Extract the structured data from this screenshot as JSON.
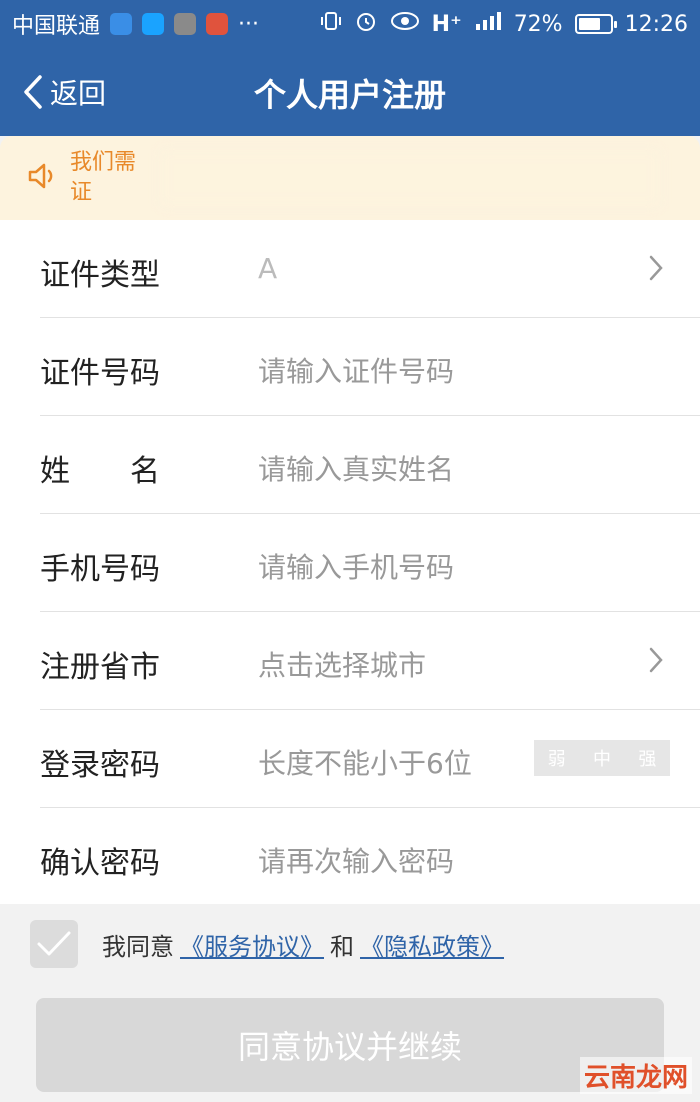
{
  "status_bar": {
    "carrier": "中国联通",
    "battery": "72%",
    "battery_level": 0.72,
    "time": "12:26",
    "notification_colors": [
      "#3a8ee6",
      "#1aa3ff",
      "#8a8a8a",
      "#e0533d"
    ]
  },
  "nav": {
    "back_label": "返回",
    "title": "个人用户注册"
  },
  "notice": {
    "text_line1": "我们需",
    "text_line2": "证"
  },
  "form": {
    "rows": [
      {
        "label": "证件类型",
        "value": "A",
        "chevron": true
      },
      {
        "label": "证件号码",
        "placeholder": "请输入证件号码"
      },
      {
        "label": "姓　　名",
        "placeholder": "请输入真实姓名"
      },
      {
        "label": "手机号码",
        "placeholder": "请输入手机号码"
      },
      {
        "label": "注册省市",
        "placeholder": "点击选择城市",
        "chevron": true
      },
      {
        "label": "登录密码",
        "placeholder": "长度不能小于6位"
      },
      {
        "label": "确认密码",
        "placeholder": "请再次输入密码"
      }
    ],
    "strength": {
      "weak": "弱",
      "medium": "中",
      "strong": "强"
    }
  },
  "agreement": {
    "prefix": "我同意",
    "service_link": "《服务协议》",
    "joiner": "和",
    "privacy_link": "《隐私政策》"
  },
  "submit_label": "同意协议并继续",
  "watermark": "云南龙网",
  "colors": {
    "primary": "#2f64a8",
    "notice_bg": "#fdf3de",
    "notice_text": "#e8892a",
    "disabled": "#d8d8d8"
  }
}
